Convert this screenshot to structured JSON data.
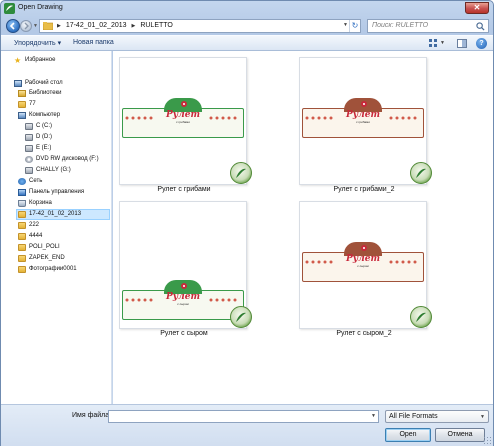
{
  "window": {
    "title": "Open Drawing",
    "close_glyph": "✕"
  },
  "navigation": {
    "breadcrumbs": [
      "17-42_01_02_2013",
      "RULETTO"
    ],
    "search_placeholder": "Поиск: RULETTO"
  },
  "toolbar": {
    "organize_label": "Упорядочить ▾",
    "new_folder_label": "Новая папка",
    "help_glyph": "?"
  },
  "sidebar": {
    "items": [
      {
        "label": "Избранное",
        "icon": "star-icon"
      },
      {
        "label": "Рабочий стол",
        "icon": "desktop-icon"
      },
      {
        "label": "Библиотеки",
        "icon": "libraries-icon"
      },
      {
        "label": "77",
        "icon": "folder-icon"
      },
      {
        "label": "Компьютер",
        "icon": "computer-icon"
      },
      {
        "label": "C (C:)",
        "icon": "drive-icon"
      },
      {
        "label": "D (D:)",
        "icon": "drive-icon"
      },
      {
        "label": "E (E:)",
        "icon": "drive-icon"
      },
      {
        "label": "DVD RW дисковод (F:)",
        "icon": "dvd-icon"
      },
      {
        "label": "CHALLY (G:)",
        "icon": "drive-icon"
      },
      {
        "label": "Сеть",
        "icon": "network-icon"
      },
      {
        "label": "Панель управления",
        "icon": "control-panel-icon"
      },
      {
        "label": "Корзина",
        "icon": "recycle-bin-icon"
      },
      {
        "label": "17-42_01_02_2013",
        "icon": "folder-icon",
        "selected": true
      },
      {
        "label": "222",
        "icon": "folder-icon"
      },
      {
        "label": "4444",
        "icon": "folder-icon"
      },
      {
        "label": "POLI_POLI",
        "icon": "folder-icon"
      },
      {
        "label": "ZAPEK_END",
        "icon": "folder-icon"
      },
      {
        "label": "Фотографии0001",
        "icon": "folder-icon"
      }
    ]
  },
  "files": [
    {
      "name": "Рулет с грибами",
      "brand": "Рулет",
      "sub": "с грибами",
      "color": "#3a9a4a"
    },
    {
      "name": "Рулет с грибами_2",
      "brand": "Рулет",
      "sub": "с грибами",
      "color": "#a0523a"
    },
    {
      "name": "Рулет с сыром",
      "brand": "Рулет",
      "sub": "с сыром",
      "color": "#3a9a4a"
    },
    {
      "name": "Рулет с сыром_2",
      "brand": "Рулет",
      "sub": "с сыром",
      "color": "#a0523a"
    }
  ],
  "footer": {
    "filename_label": "Имя файла:",
    "filename_value": "",
    "file_type": "All File Formats",
    "open_label": "Open",
    "cancel_label": "Отмена"
  },
  "colors": {
    "accent": "#2d6fc0",
    "selection": "#cde8ff",
    "label_green": "#3a9a4a",
    "label_brown": "#a0523a"
  }
}
